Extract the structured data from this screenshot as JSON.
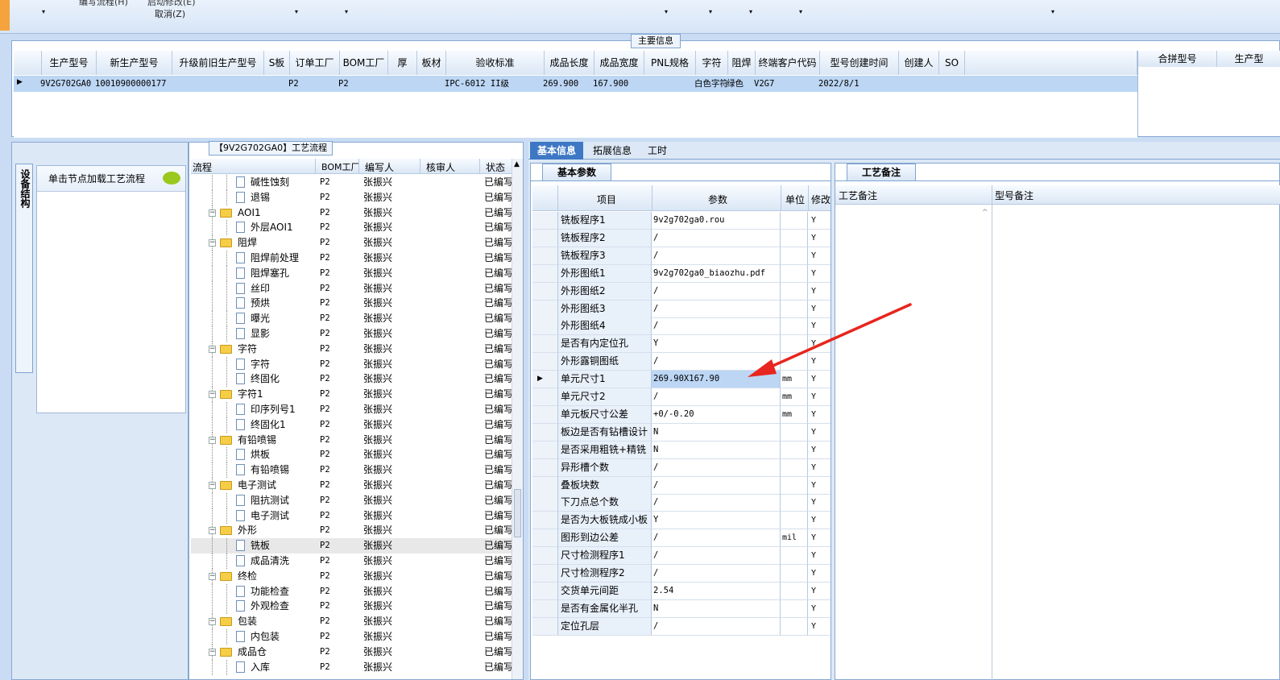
{
  "toolbar": {
    "menu_items": [
      "编写流程(H)",
      "启动修改(E)"
    ],
    "cancel": "取消(Z)"
  },
  "main_info": {
    "section_title": "主要信息",
    "columns": [
      "生产型号",
      "新生产型号",
      "升级前旧生产型号",
      "S板",
      "订单工厂",
      "BOM工厂",
      "厚",
      "板材",
      "验收标准",
      "成品长度",
      "成品宽度",
      "PNL规格",
      "字符",
      "阻焊",
      "终端客户代码",
      "型号创建时间",
      "创建人",
      "SO"
    ],
    "row": [
      "9V2G702GA0",
      "10010900000177",
      "",
      "",
      "P2",
      "P2",
      "",
      "",
      "IPC-6012 II级",
      "269.900",
      "167.900",
      "",
      "白色字符",
      "绿色",
      "V2G7",
      "2022/8/1",
      "",
      ""
    ],
    "right_columns": [
      "合拼型号",
      "生产型"
    ]
  },
  "left_panel": {
    "vertical_tab": "设备结构",
    "prompt": "单击节点加载工艺流程"
  },
  "process": {
    "title": "【9V2G702GA0】工艺流程",
    "columns": [
      "流程",
      "BOM工厂",
      "编写人",
      "核审人",
      "状态"
    ],
    "rows": [
      {
        "name": "碱性蚀刻",
        "level": 2,
        "bom": "P2",
        "writer": "张振兴",
        "status": "已编写"
      },
      {
        "name": "退锡",
        "level": 2,
        "bom": "P2",
        "writer": "张振兴",
        "status": "已编写"
      },
      {
        "name": "AOI1",
        "level": 1,
        "bom": "P2",
        "writer": "张振兴",
        "status": "已编写"
      },
      {
        "name": "外层AOI1",
        "level": 2,
        "bom": "P2",
        "writer": "张振兴",
        "status": "已编写"
      },
      {
        "name": "阻焊",
        "level": 1,
        "bom": "P2",
        "writer": "张振兴",
        "status": "已编写"
      },
      {
        "name": "阻焊前处理",
        "level": 2,
        "bom": "P2",
        "writer": "张振兴",
        "status": "已编写"
      },
      {
        "name": "阻焊塞孔",
        "level": 2,
        "bom": "P2",
        "writer": "张振兴",
        "status": "已编写"
      },
      {
        "name": "丝印",
        "level": 2,
        "bom": "P2",
        "writer": "张振兴",
        "status": "已编写"
      },
      {
        "name": "预烘",
        "level": 2,
        "bom": "P2",
        "writer": "张振兴",
        "status": "已编写"
      },
      {
        "name": "曝光",
        "level": 2,
        "bom": "P2",
        "writer": "张振兴",
        "status": "已编写"
      },
      {
        "name": "显影",
        "level": 2,
        "bom": "P2",
        "writer": "张振兴",
        "status": "已编写"
      },
      {
        "name": "字符",
        "level": 1,
        "bom": "P2",
        "writer": "张振兴",
        "status": "已编写"
      },
      {
        "name": "字符",
        "level": 2,
        "bom": "P2",
        "writer": "张振兴",
        "status": "已编写"
      },
      {
        "name": "终固化",
        "level": 2,
        "bom": "P2",
        "writer": "张振兴",
        "status": "已编写"
      },
      {
        "name": "字符1",
        "level": 1,
        "bom": "P2",
        "writer": "张振兴",
        "status": "已编写"
      },
      {
        "name": "印序列号1",
        "level": 2,
        "bom": "P2",
        "writer": "张振兴",
        "status": "已编写"
      },
      {
        "name": "终固化1",
        "level": 2,
        "bom": "P2",
        "writer": "张振兴",
        "status": "已编写"
      },
      {
        "name": "有铅喷锡",
        "level": 1,
        "bom": "P2",
        "writer": "张振兴",
        "status": "已编写"
      },
      {
        "name": "烘板",
        "level": 2,
        "bom": "P2",
        "writer": "张振兴",
        "status": "已编写"
      },
      {
        "name": "有铅喷锡",
        "level": 2,
        "bom": "P2",
        "writer": "张振兴",
        "status": "已编写"
      },
      {
        "name": "电子测试",
        "level": 1,
        "bom": "P2",
        "writer": "张振兴",
        "status": "已编写"
      },
      {
        "name": "阻抗测试",
        "level": 2,
        "bom": "P2",
        "writer": "张振兴",
        "status": "已编写"
      },
      {
        "name": "电子测试",
        "level": 2,
        "bom": "P2",
        "writer": "张振兴",
        "status": "已编写"
      },
      {
        "name": "外形",
        "level": 1,
        "bom": "P2",
        "writer": "张振兴",
        "status": "已编写"
      },
      {
        "name": "铣板",
        "level": 2,
        "bom": "P2",
        "writer": "张振兴",
        "status": "已编写",
        "selected": true
      },
      {
        "name": "成品清洗",
        "level": 2,
        "bom": "P2",
        "writer": "张振兴",
        "status": "已编写"
      },
      {
        "name": "终检",
        "level": 1,
        "bom": "P2",
        "writer": "张振兴",
        "status": "已编写"
      },
      {
        "name": "功能检查",
        "level": 2,
        "bom": "P2",
        "writer": "张振兴",
        "status": "已编写"
      },
      {
        "name": "外观检查",
        "level": 2,
        "bom": "P2",
        "writer": "张振兴",
        "status": "已编写"
      },
      {
        "name": "包装",
        "level": 1,
        "bom": "P2",
        "writer": "张振兴",
        "status": "已编写"
      },
      {
        "name": "内包装",
        "level": 2,
        "bom": "P2",
        "writer": "张振兴",
        "status": "已编写"
      },
      {
        "name": "成品仓",
        "level": 1,
        "bom": "P2",
        "writer": "张振兴",
        "status": "已编写"
      },
      {
        "name": "入库",
        "level": 2,
        "bom": "P2",
        "writer": "张振兴",
        "status": "已编写"
      }
    ]
  },
  "detail_tabs": [
    "基本信息",
    "拓展信息",
    "工时"
  ],
  "basic_params": {
    "tab": "基本参数",
    "columns": [
      "项目",
      "参数",
      "单位",
      "修改"
    ],
    "rows": [
      {
        "item": "铣板程序1",
        "value": "9v2g702ga0.rou",
        "unit": "",
        "mod": "Y"
      },
      {
        "item": "铣板程序2",
        "value": "/",
        "unit": "",
        "mod": "Y"
      },
      {
        "item": "铣板程序3",
        "value": "/",
        "unit": "",
        "mod": "Y"
      },
      {
        "item": "外形图纸1",
        "value": "9v2g702ga0_biaozhu.pdf",
        "unit": "",
        "mod": "Y"
      },
      {
        "item": "外形图纸2",
        "value": "/",
        "unit": "",
        "mod": "Y"
      },
      {
        "item": "外形图纸3",
        "value": "/",
        "unit": "",
        "mod": "Y"
      },
      {
        "item": "外形图纸4",
        "value": "/",
        "unit": "",
        "mod": "Y"
      },
      {
        "item": "是否有内定位孔",
        "value": "Y",
        "unit": "",
        "mod": "Y"
      },
      {
        "item": "外形露铜图纸",
        "value": "/",
        "unit": "",
        "mod": "Y"
      },
      {
        "item": "单元尺寸1",
        "value": "269.90X167.90",
        "unit": "mm",
        "mod": "Y",
        "current": true
      },
      {
        "item": "单元尺寸2",
        "value": "/",
        "unit": "mm",
        "mod": "Y"
      },
      {
        "item": "单元板尺寸公差",
        "value": "+0/-0.20",
        "unit": "mm",
        "mod": "Y"
      },
      {
        "item": "板边是否有钻槽设计",
        "value": "N",
        "unit": "",
        "mod": "Y"
      },
      {
        "item": "是否采用粗铣+精铣",
        "value": "N",
        "unit": "",
        "mod": "Y"
      },
      {
        "item": "异形槽个数",
        "value": "/",
        "unit": "",
        "mod": "Y"
      },
      {
        "item": "叠板块数",
        "value": "/",
        "unit": "",
        "mod": "Y"
      },
      {
        "item": "下刀点总个数",
        "value": "/",
        "unit": "",
        "mod": "Y"
      },
      {
        "item": "是否为大板铣成小板",
        "value": "Y",
        "unit": "",
        "mod": "Y"
      },
      {
        "item": "图形到边公差",
        "value": "/",
        "unit": "mil",
        "mod": "Y"
      },
      {
        "item": "尺寸检测程序1",
        "value": "/",
        "unit": "",
        "mod": "Y"
      },
      {
        "item": "尺寸检测程序2",
        "value": "/",
        "unit": "",
        "mod": "Y"
      },
      {
        "item": "交货单元间距",
        "value": "2.54",
        "unit": "",
        "mod": "Y"
      },
      {
        "item": "是否有金属化半孔",
        "value": "N",
        "unit": "",
        "mod": "Y"
      },
      {
        "item": "定位孔层",
        "value": "/",
        "unit": "",
        "mod": "Y"
      }
    ]
  },
  "process_notes": {
    "tab": "工艺备注",
    "columns": [
      "工艺备注",
      "型号备注"
    ]
  },
  "colors": {
    "accent": "#e8251e",
    "selection": "#bcd6f4",
    "header": "#dbe7f5"
  }
}
